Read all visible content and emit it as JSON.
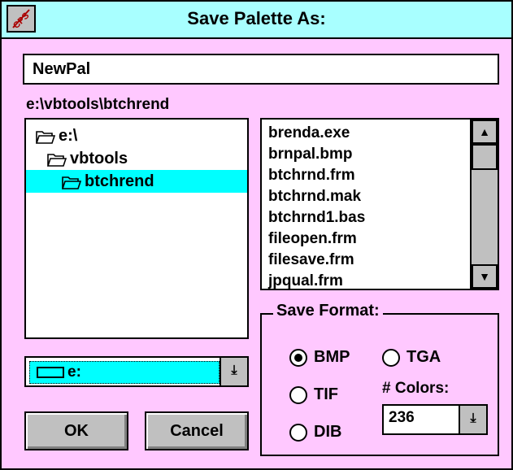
{
  "window": {
    "title": "Save Palette As:",
    "sys_icon_text": "CPS"
  },
  "filename": {
    "value": "NewPal"
  },
  "path": {
    "label": "e:\\vbtools\\btchrend"
  },
  "directories": [
    {
      "label": "e:\\"
    },
    {
      "label": "vbtools"
    },
    {
      "label": "btchrend"
    }
  ],
  "files": [
    "brenda.exe",
    "brnpal.bmp",
    "btchrnd.frm",
    "btchrnd.mak",
    "btchrnd1.bas",
    "fileopen.frm",
    "filesave.frm",
    "jpqual.frm"
  ],
  "drive": {
    "value": "e:"
  },
  "buttons": {
    "ok": "OK",
    "cancel": "Cancel"
  },
  "format": {
    "title": "Save Format:",
    "options": [
      "BMP",
      "TGA",
      "TIF",
      "DIB"
    ],
    "selected": "BMP",
    "colors_label": "# Colors:",
    "colors_value": "236"
  },
  "colors": {
    "background": "#ffc8ff",
    "titlebar": "#a8ffff",
    "selection": "#00ffff"
  }
}
